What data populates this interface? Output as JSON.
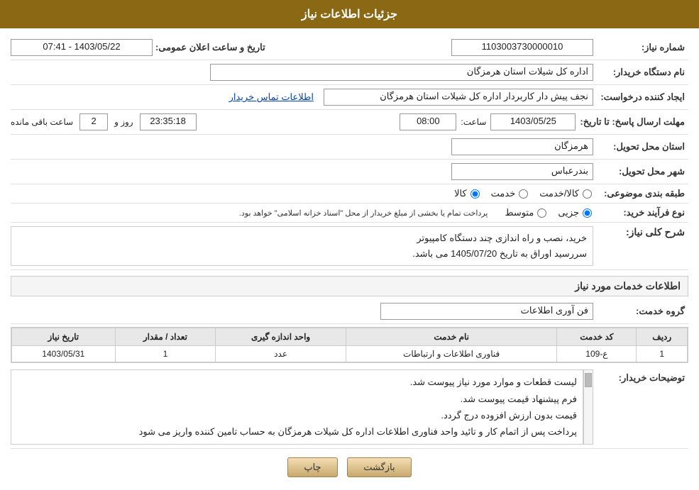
{
  "header": {
    "title": "جزئیات اطلاعات نیاز"
  },
  "fields": {
    "need_number_label": "شماره نیاز:",
    "need_number_value": "1103003730000010",
    "announcement_date_label": "تاریخ و ساعت اعلان عمومی:",
    "announcement_date_value": "1403/05/22 - 07:41",
    "buyer_name_label": "نام دستگاه خریدار:",
    "buyer_name_value": "اداره کل شیلات استان هرمزگان",
    "creator_label": "ایجاد کننده درخواست:",
    "creator_value": "نجف پیش دار کاربردار اداره کل شیلات استان هرمزگان",
    "contact_link": "اطلاعات تماس خریدار",
    "deadline_label": "مهلت ارسال پاسخ: تا تاریخ:",
    "deadline_date": "1403/05/25",
    "deadline_time_label": "ساعت:",
    "deadline_time": "08:00",
    "remaining_label": "روز و",
    "remaining_days": "2",
    "remaining_time": "23:35:18",
    "remaining_suffix": "ساعت باقی مانده",
    "province_label": "استان محل تحویل:",
    "province_value": "هرمزگان",
    "city_label": "شهر محل تحویل:",
    "city_value": "بندرعباس",
    "category_label": "طبقه بندی موضوعی:",
    "category_kala": "کالا",
    "category_khadamat": "خدمت",
    "category_kala_khadamat": "کالا/خدمت",
    "purchase_type_label": "نوع فرآیند خرید:",
    "purchase_jozyi": "جزیی",
    "purchase_motavaset": "متوسط",
    "purchase_note": "پرداخت تمام یا بخشی از مبلغ خریدار از محل \"اسناد خزانه اسلامی\" خواهد بود.",
    "description_section_label": "شرح کلی نیاز:",
    "description_value": "خرید، نصب و راه اندازی چند دستگاه کامپیوتر\nسررسید اوراق به تاریخ 1405/07/20 می باشد.",
    "services_section_label": "اطلاعات خدمات مورد نیاز",
    "service_group_label": "گروه خدمت:",
    "service_group_value": "فن آوری اطلاعات",
    "table": {
      "col_row": "ردیف",
      "col_code": "کد خدمت",
      "col_name": "نام خدمت",
      "col_unit": "واحد اندازه گیری",
      "col_qty": "تعداد / مقدار",
      "col_date": "تاریخ نیاز",
      "rows": [
        {
          "row": "1",
          "code": "ع-109",
          "name": "فناوری اطلاعات و ارتباطات",
          "unit": "عدد",
          "qty": "1",
          "date": "1403/05/31"
        }
      ]
    },
    "buyer_desc_label": "توضیحات خریدار:",
    "buyer_desc_lines": [
      "لیست قطعات و موارد مورد نیاز پیوست شد.",
      "فرم پیشنهاد قیمت پیوست شد.",
      "قیمت بدون ارزش افزوده درج گردد.",
      "پرداخت پس از اتمام کار و تائید واحد فناوری اطلاعات اداره کل شیلات هرمزگان به حساب تامین کننده واریز می شود"
    ]
  },
  "buttons": {
    "back_label": "بازگشت",
    "print_label": "چاپ"
  }
}
